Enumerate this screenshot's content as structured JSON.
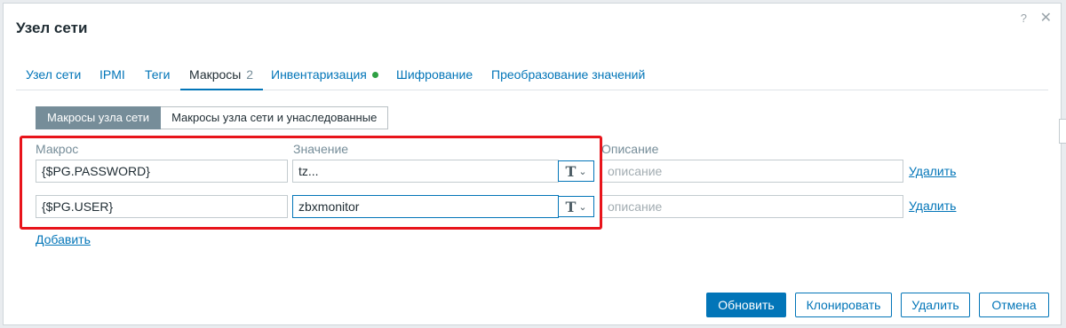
{
  "dialog": {
    "title": "Узел сети"
  },
  "tabs": [
    {
      "label": "Узел сети"
    },
    {
      "label": "IPMI"
    },
    {
      "label": "Теги"
    },
    {
      "label": "Макросы",
      "count": "2"
    },
    {
      "label": "Инвентаризация"
    },
    {
      "label": "Шифрование"
    },
    {
      "label": "Преобразование значений"
    }
  ],
  "macro_view": {
    "options": [
      "Макросы узла сети",
      "Макросы узла сети и унаследованные"
    ],
    "selected": "Макросы узла сети"
  },
  "columns": {
    "macro": "Макрос",
    "value": "Значение",
    "description": "Описание"
  },
  "macros": [
    {
      "macro": "{$PG.PASSWORD}",
      "value": "tz...",
      "description_placeholder": "описание",
      "remove": "Удалить"
    },
    {
      "macro": "{$PG.USER}",
      "value": "zbxmonitor",
      "description_placeholder": "описание",
      "remove": "Удалить"
    }
  ],
  "add_link": "Добавить",
  "buttons": {
    "update": "Обновить",
    "clone": "Клонировать",
    "delete": "Удалить",
    "cancel": "Отмена"
  },
  "icons": {
    "value_type": "T",
    "help": "?",
    "close": "✕",
    "chevron": "⌄"
  },
  "colors": {
    "accent": "#0275b8",
    "highlight": "#e8141b",
    "status_ok": "#2ea043"
  }
}
